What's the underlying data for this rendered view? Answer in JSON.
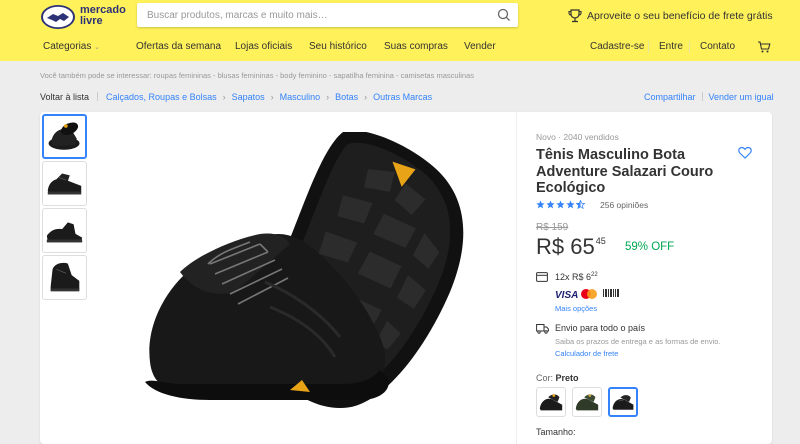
{
  "header": {
    "logo_line1": "mercado",
    "logo_line2": "livre",
    "search_placeholder": "Buscar produtos, marcas e muito mais…",
    "promo_text": "Aproveite o seu benefício de frete grátis",
    "nav_left": [
      "Categorias",
      "Ofertas da semana",
      "Lojas oficiais",
      "Seu histórico",
      "Suas compras",
      "Vender"
    ],
    "nav_right": [
      "Cadastre-se",
      "Entre",
      "Contato"
    ]
  },
  "related": "Você também pode se interessar: roupas femininas - blusas femininas - body feminino - sapatilha feminina - camisetas masculinas",
  "breadcrumb": {
    "back": "Voltar à lista",
    "items": [
      "Calçados, Roupas e Bolsas",
      "Sapatos",
      "Masculino",
      "Botas",
      "Outras Marcas"
    ],
    "share": "Compartilhar",
    "sell": "Vender um igual"
  },
  "product": {
    "condition": "Novo  ·  2040 vendidos",
    "title": "Tênis Masculino Bota Adventure Salazari Couro Ecológico",
    "rating": 4.5,
    "reviews": "256 opiniões",
    "old_price": "R$ 159",
    "price_currency": "R$",
    "price_int": "65",
    "price_cents": "45",
    "discount": "59% OFF",
    "installments_pre": "12x R$ 6",
    "installments_cents": "22",
    "more_options": "Mais opções",
    "shipping_title": "Envio para todo o país",
    "shipping_sub": "Saiba os prazos de entrega e as formas de envio.",
    "shipping_calc": "Calculador de frete",
    "color_label": "Cor:",
    "color_value": "Preto",
    "size_label": "Tamanho:"
  },
  "colors": {
    "header_bg": "#fff159",
    "link": "#3483fa",
    "discount": "#00a650"
  }
}
